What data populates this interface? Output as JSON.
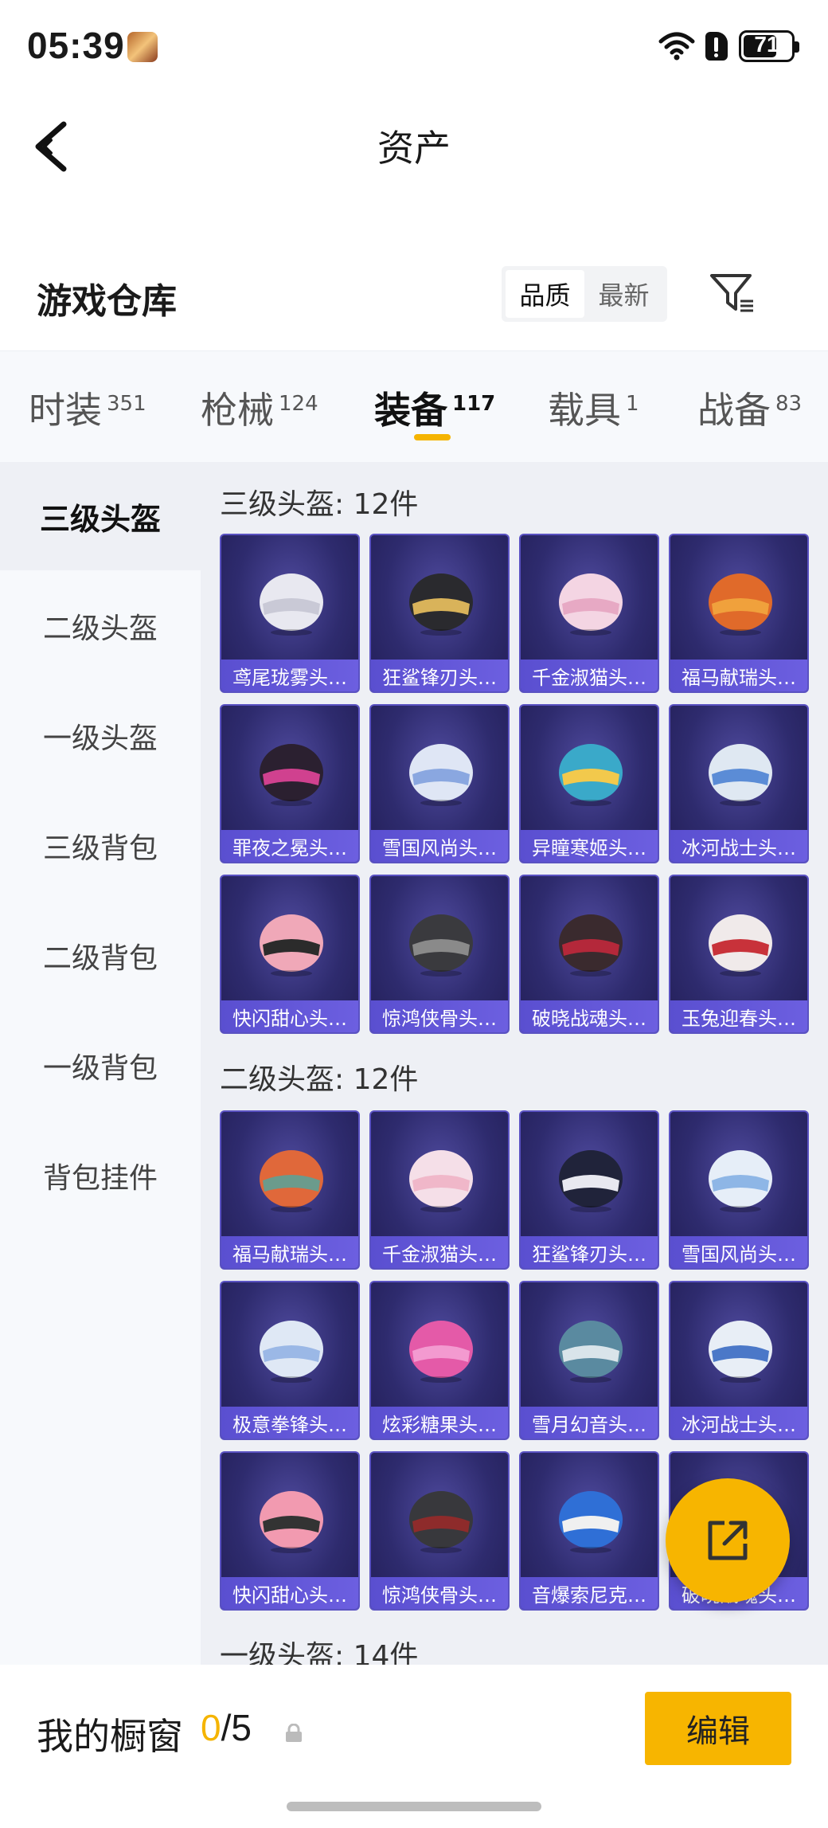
{
  "status_bar": {
    "time": "05:39",
    "battery": "71",
    "battery_level": 0.71
  },
  "header": {
    "title": "资产"
  },
  "section": {
    "title": "游戏仓库",
    "sort_options": [
      "品质",
      "最新"
    ],
    "active_sort": 0
  },
  "tabs": [
    {
      "label": "时装",
      "count": "351"
    },
    {
      "label": "枪械",
      "count": "124"
    },
    {
      "label": "装备",
      "count": "117",
      "active": true
    },
    {
      "label": "载具",
      "count": "1"
    },
    {
      "label": "战备",
      "count": "83"
    }
  ],
  "side_nav": [
    "三级头盔",
    "二级头盔",
    "一级头盔",
    "三级背包",
    "二级背包",
    "一级背包",
    "背包挂件"
  ],
  "groups": [
    {
      "title": "三级头盔: 12件",
      "items": [
        "鸢尾珑雾头…",
        "狂鲨锋刃头…",
        "千金淑猫头…",
        "福马献瑞头…",
        "罪夜之冕头…",
        "雪国风尚头…",
        "异瞳寒姬头…",
        "冰河战士头…",
        "快闪甜心头…",
        "惊鸿侠骨头…",
        "破晓战魂头…",
        "玉兔迎春头…"
      ]
    },
    {
      "title": "二级头盔: 12件",
      "items": [
        "福马献瑞头…",
        "千金淑猫头…",
        "狂鲨锋刃头…",
        "雪国风尚头…",
        "极意拳锋头…",
        "炫彩糖果头…",
        "雪月幻音头…",
        "冰河战士头…",
        "快闪甜心头…",
        "惊鸿侠骨头…",
        "音爆索尼克…",
        "破晓战魂头…"
      ]
    },
    {
      "title": "一级头盔: 14件",
      "items": []
    }
  ],
  "bottom": {
    "showcase_label": "我的橱窗",
    "showcase_current": "0",
    "showcase_total": "/5",
    "edit_label": "编辑"
  },
  "colors": {
    "accent": "#f5b400",
    "card_bg": "#2e2b6e",
    "card_caption": "#5a4fd0"
  }
}
